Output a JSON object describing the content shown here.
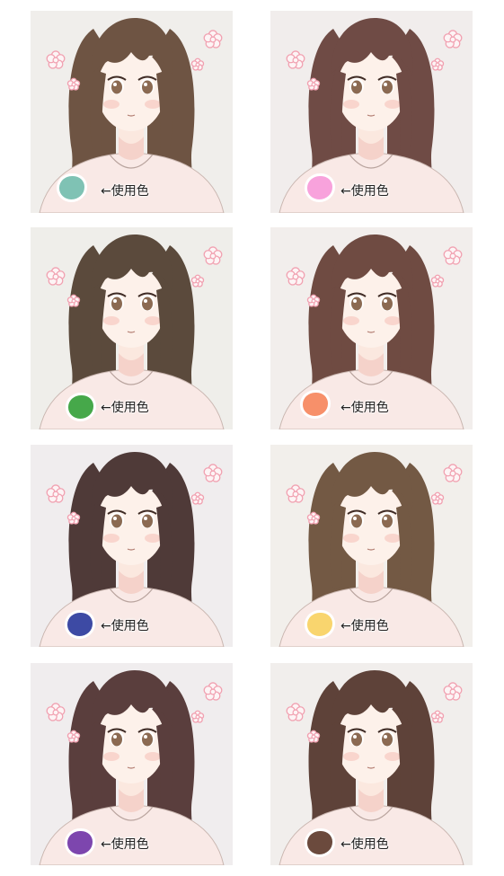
{
  "panels": [
    {
      "id": "teal",
      "swatch_color": "#7fc2b4",
      "label": "←使用色",
      "tint": "#f0eeeb",
      "hair": "#6e5443"
    },
    {
      "id": "pink",
      "swatch_color": "#f8a2dc",
      "label": "←使用色",
      "tint": "#f1edec",
      "hair": "#6f4b45"
    },
    {
      "id": "green",
      "swatch_color": "#46a84a",
      "label": "←使用色",
      "tint": "#efeeea",
      "hair": "#5b4a3c"
    },
    {
      "id": "orange",
      "swatch_color": "#f7906a",
      "label": "←使用色",
      "tint": "#f2eeec",
      "hair": "#6f4b42"
    },
    {
      "id": "indigo",
      "swatch_color": "#3d4aa4",
      "label": "←使用色",
      "tint": "#f0edee",
      "hair": "#4f3a38"
    },
    {
      "id": "yellow",
      "swatch_color": "#f9d56e",
      "label": "←使用色",
      "tint": "#f2efeb",
      "hair": "#735944"
    },
    {
      "id": "purple",
      "swatch_color": "#7d46ae",
      "label": "←使用色",
      "tint": "#f0edee",
      "hair": "#5a3e3d"
    },
    {
      "id": "brown",
      "swatch_color": "#6b4a3d",
      "label": "←使用色",
      "tint": "#f1eeec",
      "hair": "#5e4239"
    }
  ],
  "icons": {
    "flower": "flower-icon",
    "swatch": "color-swatch"
  }
}
